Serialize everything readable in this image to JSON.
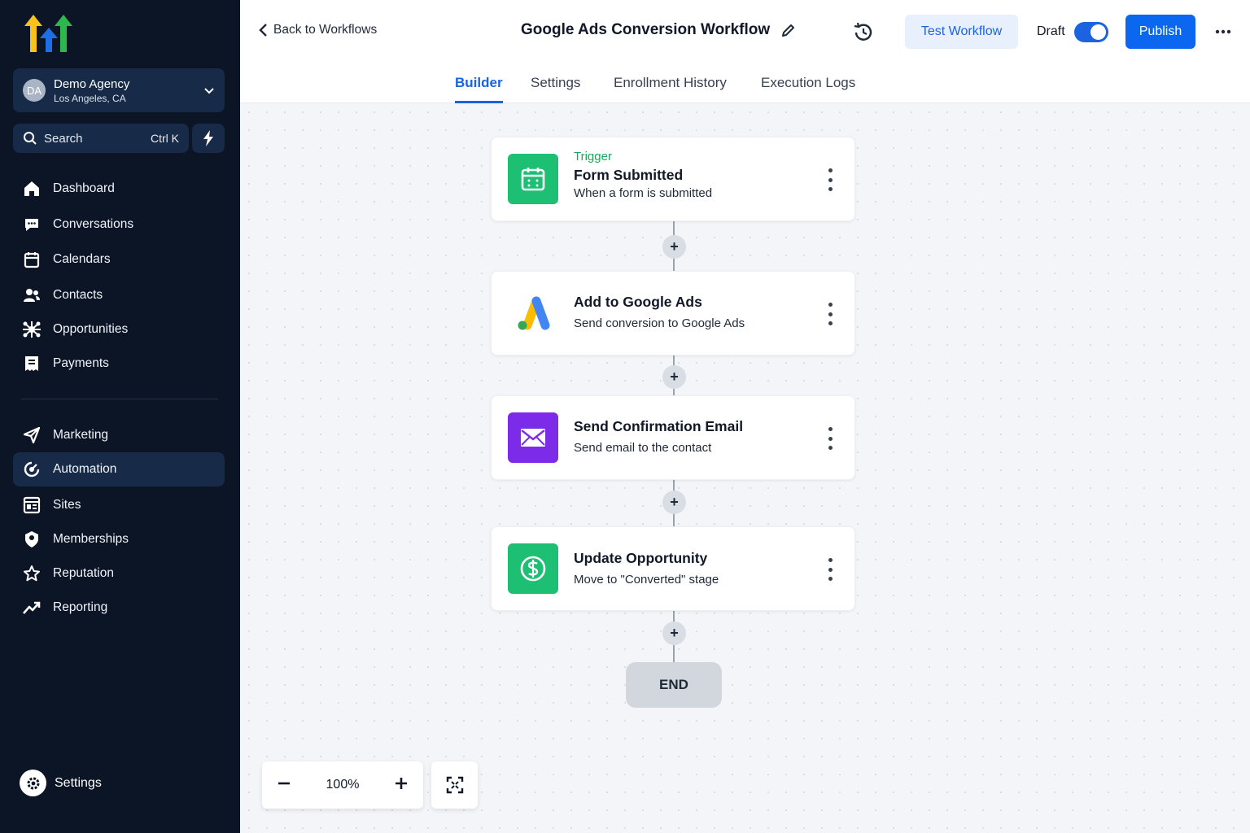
{
  "sidebar": {
    "agency": {
      "initials": "DA",
      "name": "Demo Agency",
      "location": "Los Angeles, CA"
    },
    "search": {
      "label": "Search",
      "shortcut": "Ctrl K"
    },
    "nav_primary": [
      {
        "label": "Dashboard",
        "icon": "home-icon"
      },
      {
        "label": "Conversations",
        "icon": "chat-icon"
      },
      {
        "label": "Calendars",
        "icon": "calendar-icon"
      },
      {
        "label": "Contacts",
        "icon": "contacts-icon"
      },
      {
        "label": "Opportunities",
        "icon": "opportunities-icon"
      },
      {
        "label": "Payments",
        "icon": "payments-icon"
      }
    ],
    "nav_secondary": [
      {
        "label": "Marketing",
        "icon": "send-icon"
      },
      {
        "label": "Automation",
        "icon": "automation-icon",
        "active": true
      },
      {
        "label": "Sites",
        "icon": "sites-icon"
      },
      {
        "label": "Memberships",
        "icon": "memberships-icon"
      },
      {
        "label": "Reputation",
        "icon": "star-icon"
      },
      {
        "label": "Reporting",
        "icon": "trend-icon"
      }
    ],
    "settings_label": "Settings"
  },
  "header": {
    "back_label": "Back to Workflows",
    "title": "Google Ads Conversion Workflow",
    "test_label": "Test Workflow",
    "draft_label": "Draft",
    "draft_enabled": true,
    "publish_label": "Publish"
  },
  "tabs": [
    {
      "label": "Builder",
      "active": true
    },
    {
      "label": "Settings"
    },
    {
      "label": "Enrollment History"
    },
    {
      "label": "Execution Logs"
    }
  ],
  "workflow": {
    "steps": [
      {
        "kicker": "Trigger",
        "title": "Form Submitted",
        "subtitle": "When a form is submitted",
        "icon": "calendar-icon",
        "color": "#1dbf73"
      },
      {
        "title": "Add to Google Ads",
        "subtitle": "Send conversion to Google Ads",
        "icon": "google-ads-icon"
      },
      {
        "title": "Send Confirmation Email",
        "subtitle": "Send email to the contact",
        "icon": "mail-icon",
        "color": "#7c2be8"
      },
      {
        "title": "Update Opportunity",
        "subtitle": "Move to \"Converted\" stage",
        "icon": "dollar-icon",
        "color": "#1dbf73"
      }
    ],
    "add_symbol": "+",
    "end_label": "END"
  },
  "zoom": {
    "value": "100%"
  },
  "colors": {
    "accent": "#1b63e0",
    "publish": "#0b66f0",
    "sidebar": "#0b1526",
    "trigger": "#1aa85a"
  }
}
